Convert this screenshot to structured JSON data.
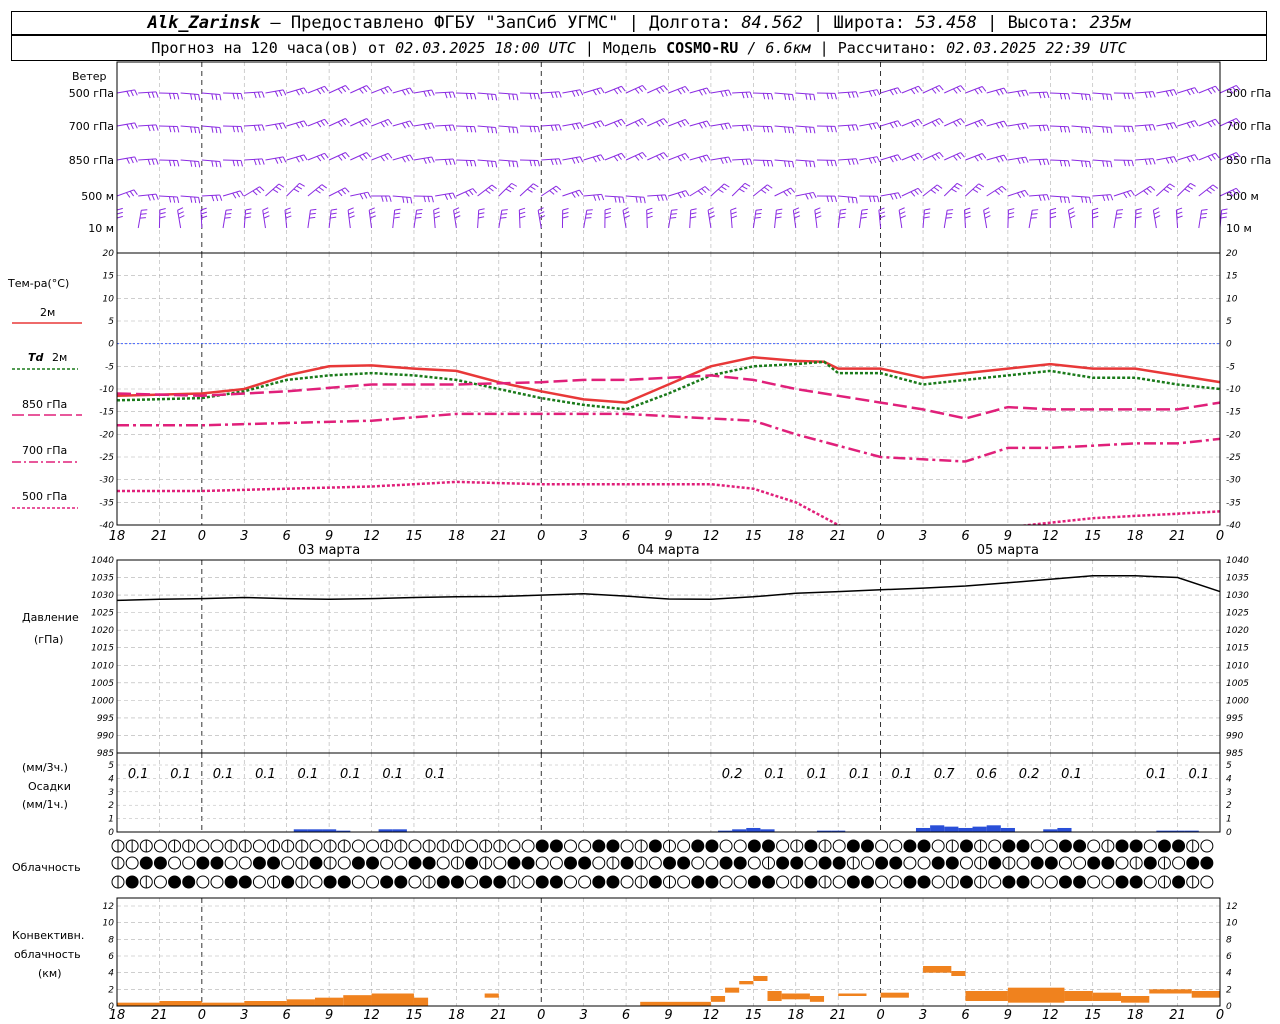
{
  "header": {
    "station": "Alk_Zarinsk",
    "provider": "– Предоставлено ФГБУ \"ЗапСиб УГМС\"",
    "lon_label": "Долгота:",
    "lon": "84.562",
    "lat_label": "Широта:",
    "lat": "53.458",
    "alt_label": "Высота:",
    "alt": "235м",
    "sep": "|"
  },
  "subheader": {
    "forecast_label": "Прогноз на 120 часа(ов) от",
    "forecast_time": "02.03.2025 18:00 UTC",
    "model_label": "Модель",
    "model": "COSMO-RU",
    "resolution": "/ 6.6км",
    "calc_label": "Рассчитано:",
    "calc_time": "02.03.2025 22:39 UTC",
    "sep": "|"
  },
  "labels": {
    "wind": "Ветер",
    "temp": "Тем-ра(°C)",
    "t2m": "2м",
    "td": "Td",
    "td2m": "2м",
    "t850": "850 гПа",
    "t700": "700 гПа",
    "t500": "500 гПа",
    "pressure": "Давление",
    "pressure_unit": "(гПа)",
    "precip_unit3": "(мм/3ч.)",
    "precip": "Осадки",
    "precip_unit1": "(мм/1ч.)",
    "cloud": "Облачность",
    "conv1": "Конвективн.",
    "conv2": "облачность",
    "conv_unit": "(км)"
  },
  "wind_levels": [
    "500 гПа",
    "700 гПа",
    "850 гПа",
    "500 м",
    "10  м"
  ],
  "x_hour_labels": [
    "18",
    "21",
    "0",
    "3",
    "6",
    "9",
    "12",
    "15",
    "18",
    "21",
    "0",
    "3",
    "6",
    "9",
    "12",
    "15",
    "18",
    "21",
    "0",
    "3",
    "6",
    "9",
    "12",
    "15",
    "18",
    "21",
    "0"
  ],
  "day_labels": [
    {
      "text": "03 марта",
      "hour": 15
    },
    {
      "text": "04 марта",
      "hour": 39
    },
    {
      "text": "05 марта",
      "hour": 63
    }
  ],
  "colors": {
    "wind": "#8a2be2",
    "t2m": "#e83838",
    "td": "#1a7a1a",
    "t850": "#e0207a",
    "t700": "#e0207a",
    "t500": "#e0207a",
    "pressure": "#000000",
    "precip": "#2a4fd8",
    "conv": "#f0821e",
    "zero": "#4060ff",
    "grid": "#b0b0b0"
  },
  "chart_data": [
    {
      "type": "line",
      "panel": "temperature",
      "x_unit": "hours since 02.03.2025 18:00 UTC",
      "ylim": [
        -40,
        20
      ],
      "yticks": [
        -40,
        -35,
        -30,
        -25,
        -20,
        -15,
        -10,
        -5,
        0,
        5,
        10,
        15,
        20
      ],
      "series": [
        {
          "key": "t2m",
          "x": [
            0,
            6,
            9,
            12,
            15,
            18,
            21,
            24,
            27,
            30,
            33,
            36,
            39,
            42,
            45,
            48,
            50,
            51,
            54,
            57,
            60,
            63,
            66,
            69,
            72,
            75,
            78
          ],
          "values": [
            -11.5,
            -11,
            -10,
            -7,
            -5,
            -4.8,
            -5.5,
            -6,
            -8.5,
            -10.5,
            -12.3,
            -13,
            -9,
            -5,
            -3,
            -3.8,
            -4,
            -5.5,
            -5.5,
            -7.5,
            -6.5,
            -5.5,
            -4.5,
            -5.5,
            -5.5,
            -7,
            -8.5
          ]
        },
        {
          "key": "td",
          "x": [
            0,
            6,
            9,
            12,
            15,
            18,
            21,
            24,
            27,
            30,
            33,
            36,
            39,
            42,
            45,
            48,
            50,
            51,
            54,
            57,
            60,
            63,
            66,
            69,
            72,
            75,
            78
          ],
          "values": [
            -12.5,
            -12,
            -10.5,
            -8,
            -7,
            -6.5,
            -7,
            -8,
            -10,
            -12,
            -13.5,
            -14.5,
            -11,
            -7,
            -5,
            -4.5,
            -4,
            -6.5,
            -6.5,
            -9,
            -8,
            -7,
            -6,
            -7.5,
            -7.5,
            -9,
            -10
          ]
        },
        {
          "key": "t850",
          "x": [
            0,
            6,
            12,
            18,
            24,
            30,
            33,
            36,
            39,
            42,
            45,
            48,
            51,
            54,
            57,
            60,
            63,
            66,
            69,
            72,
            75,
            78
          ],
          "values": [
            -11,
            -11.5,
            -10.5,
            -9,
            -9,
            -8.5,
            -8,
            -8,
            -7.5,
            -7,
            -8,
            -10,
            -11.5,
            -13,
            -14.5,
            -16.5,
            -14,
            -14.5,
            -14.5,
            -14.5,
            -14.5,
            -13
          ]
        },
        {
          "key": "t700",
          "x": [
            0,
            6,
            12,
            18,
            24,
            30,
            36,
            39,
            42,
            45,
            48,
            51,
            54,
            57,
            60,
            63,
            66,
            69,
            72,
            75,
            78
          ],
          "values": [
            -18,
            -18,
            -17.5,
            -17,
            -15.5,
            -15.5,
            -15.5,
            -16,
            -16.5,
            -17,
            -20,
            -22.5,
            -25,
            -25.5,
            -26,
            -23,
            -23,
            -22.5,
            -22,
            -22,
            -21
          ]
        },
        {
          "key": "t500",
          "x": [
            0,
            6,
            12,
            18,
            24,
            30,
            36,
            39,
            42,
            45,
            48,
            51,
            54
          ],
          "values": [
            -32.5,
            -32.5,
            -32,
            -31.5,
            -30.5,
            -31,
            -31,
            -31,
            -31,
            -32,
            -35,
            -40,
            -43
          ]
        },
        {
          "key": "t500b",
          "x": [
            63,
            66,
            69,
            72,
            75,
            78
          ],
          "values": [
            -40.5,
            -39.5,
            -38.5,
            -38,
            -37.5,
            -37
          ]
        }
      ]
    },
    {
      "type": "line",
      "panel": "pressure",
      "x_unit": "hours since 02.03.2025 18:00 UTC",
      "ylim": [
        985,
        1040
      ],
      "yticks": [
        985,
        990,
        995,
        1000,
        1005,
        1010,
        1015,
        1020,
        1025,
        1030,
        1035,
        1040
      ],
      "series": [
        {
          "key": "pressure",
          "x": [
            0,
            3,
            6,
            9,
            12,
            15,
            18,
            21,
            24,
            27,
            30,
            33,
            36,
            39,
            42,
            45,
            48,
            51,
            54,
            57,
            60,
            63,
            66,
            69,
            72,
            75,
            78
          ],
          "values": [
            1028.5,
            1028.8,
            1029,
            1029.3,
            1029,
            1028.8,
            1029,
            1029.3,
            1029.5,
            1029.6,
            1030,
            1030.4,
            1029.7,
            1028.9,
            1028.8,
            1029.5,
            1030.5,
            1031,
            1031.5,
            1032,
            1032.6,
            1033.5,
            1034.5,
            1035.5,
            1035.5,
            1035,
            1031
          ]
        }
      ]
    },
    {
      "type": "bar",
      "panel": "precipitation",
      "x_unit": "hours since 02.03.2025 18:00 UTC",
      "ylim": [
        0,
        5
      ],
      "yticks": [
        0,
        1,
        2,
        3,
        4,
        5
      ],
      "labels_3h": [
        {
          "hour": 1.5,
          "text": "0.1"
        },
        {
          "hour": 4.5,
          "text": "0.1"
        },
        {
          "hour": 7.5,
          "text": "0.1"
        },
        {
          "hour": 10.5,
          "text": "0.1"
        },
        {
          "hour": 13.5,
          "text": "0.1"
        },
        {
          "hour": 16.5,
          "text": "0.1"
        },
        {
          "hour": 19.5,
          "text": "0.1"
        },
        {
          "hour": 22.5,
          "text": "0.1"
        },
        {
          "hour": 43.5,
          "text": "0.2"
        },
        {
          "hour": 46.5,
          "text": "0.1"
        },
        {
          "hour": 49.5,
          "text": "0.1"
        },
        {
          "hour": 52.5,
          "text": "0.1"
        },
        {
          "hour": 55.5,
          "text": "0.1"
        },
        {
          "hour": 58.5,
          "text": "0.7"
        },
        {
          "hour": 61.5,
          "text": "0.6"
        },
        {
          "hour": 64.5,
          "text": "0.2"
        },
        {
          "hour": 67.5,
          "text": "0.1"
        },
        {
          "hour": 73.5,
          "text": "0.1"
        },
        {
          "hour": 76.5,
          "text": "0.1"
        }
      ],
      "x": [
        13,
        14,
        15,
        16,
        19,
        20,
        43,
        44,
        45,
        46,
        50,
        51,
        57,
        58,
        59,
        60,
        61,
        62,
        63,
        66,
        67,
        74,
        75,
        76
      ],
      "values": [
        0.2,
        0.2,
        0.2,
        0.1,
        0.2,
        0.2,
        0.1,
        0.2,
        0.3,
        0.2,
        0.1,
        0.1,
        0.3,
        0.5,
        0.4,
        0.3,
        0.4,
        0.5,
        0.3,
        0.2,
        0.3,
        0.1,
        0.1,
        0.1
      ]
    },
    {
      "type": "bar",
      "panel": "convective_cloud",
      "x_unit": "hours since 02.03.2025 18:00 UTC",
      "ylim": [
        0,
        12
      ],
      "yticks": [
        0,
        2,
        4,
        6,
        8,
        10,
        12
      ],
      "bars": [
        {
          "x0": 0,
          "x1": 3,
          "base": 0,
          "top": 0.4
        },
        {
          "x0": 3,
          "x1": 6,
          "base": 0,
          "top": 0.6
        },
        {
          "x0": 6,
          "x1": 9,
          "base": 0,
          "top": 0.4
        },
        {
          "x0": 9,
          "x1": 12,
          "base": 0,
          "top": 0.6
        },
        {
          "x0": 12,
          "x1": 14,
          "base": 0,
          "top": 0.8
        },
        {
          "x0": 14,
          "x1": 16,
          "base": 0,
          "top": 1
        },
        {
          "x0": 16,
          "x1": 18,
          "base": 0,
          "top": 1.3
        },
        {
          "x0": 18,
          "x1": 21,
          "base": 0,
          "top": 1.5
        },
        {
          "x0": 21,
          "x1": 22,
          "base": 0,
          "top": 1
        },
        {
          "x0": 26,
          "x1": 27,
          "base": 1,
          "top": 1.5
        },
        {
          "x0": 37,
          "x1": 42,
          "base": 0,
          "top": 0.5
        },
        {
          "x0": 42,
          "x1": 43,
          "base": 0.5,
          "top": 1.2
        },
        {
          "x0": 43,
          "x1": 44,
          "base": 1.6,
          "top": 2.2
        },
        {
          "x0": 44,
          "x1": 45,
          "base": 2.6,
          "top": 3
        },
        {
          "x0": 45,
          "x1": 46,
          "base": 3,
          "top": 3.6
        },
        {
          "x0": 46,
          "x1": 47,
          "base": 0.6,
          "top": 1.8
        },
        {
          "x0": 47,
          "x1": 49,
          "base": 0.8,
          "top": 1.5
        },
        {
          "x0": 49,
          "x1": 50,
          "base": 0.5,
          "top": 1.2
        },
        {
          "x0": 51,
          "x1": 53,
          "base": 1.2,
          "top": 1.5
        },
        {
          "x0": 54,
          "x1": 56,
          "base": 1,
          "top": 1.6
        },
        {
          "x0": 57,
          "x1": 59,
          "base": 4,
          "top": 4.8
        },
        {
          "x0": 59,
          "x1": 60,
          "base": 3.6,
          "top": 4.2
        },
        {
          "x0": 60,
          "x1": 63,
          "base": 0.6,
          "top": 1.8
        },
        {
          "x0": 63,
          "x1": 67,
          "base": 0.4,
          "top": 2.2
        },
        {
          "x0": 67,
          "x1": 69,
          "base": 0.6,
          "top": 1.8
        },
        {
          "x0": 69,
          "x1": 71,
          "base": 0.6,
          "top": 1.6
        },
        {
          "x0": 71,
          "x1": 73,
          "base": 0.4,
          "top": 1.2
        },
        {
          "x0": 73,
          "x1": 76,
          "base": 1.5,
          "top": 2
        },
        {
          "x0": 76,
          "x1": 78,
          "base": 1,
          "top": 1.8
        }
      ]
    }
  ]
}
